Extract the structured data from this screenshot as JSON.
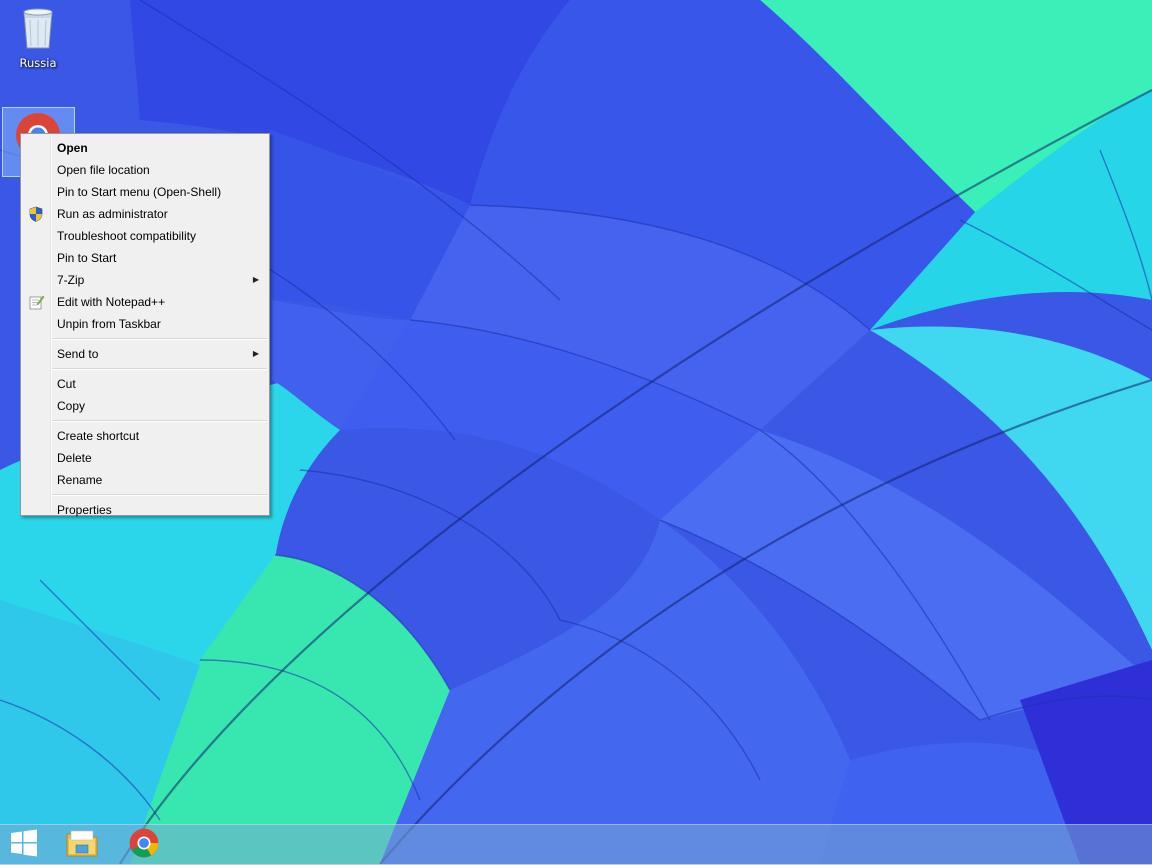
{
  "desktop": {
    "icons": [
      {
        "label": "Russia",
        "icon": "recycle-bin-icon"
      },
      {
        "label": "",
        "icon": "chrome-icon"
      }
    ]
  },
  "context_menu": {
    "groups": [
      [
        {
          "label": "Open",
          "bold": true
        },
        {
          "label": "Open file location"
        },
        {
          "label": "Pin to Start menu (Open-Shell)"
        },
        {
          "label": "Run as administrator",
          "icon": "uac-shield-icon"
        },
        {
          "label": "Troubleshoot compatibility"
        },
        {
          "label": "Pin to Start"
        },
        {
          "label": "7-Zip",
          "submenu": true
        },
        {
          "label": "Edit with Notepad++",
          "icon": "notepadpp-icon"
        },
        {
          "label": "Unpin from Taskbar"
        }
      ],
      [
        {
          "label": "Send to",
          "submenu": true
        }
      ],
      [
        {
          "label": "Cut"
        },
        {
          "label": "Copy"
        }
      ],
      [
        {
          "label": "Create shortcut"
        },
        {
          "label": "Delete"
        },
        {
          "label": "Rename"
        }
      ],
      [
        {
          "label": "Properties"
        }
      ]
    ]
  },
  "taskbar": {
    "buttons": [
      {
        "name": "start-button",
        "icon": "windows-logo-icon"
      },
      {
        "name": "file-explorer-button",
        "icon": "file-explorer-icon"
      },
      {
        "name": "chrome-button",
        "icon": "chrome-icon"
      }
    ]
  }
}
